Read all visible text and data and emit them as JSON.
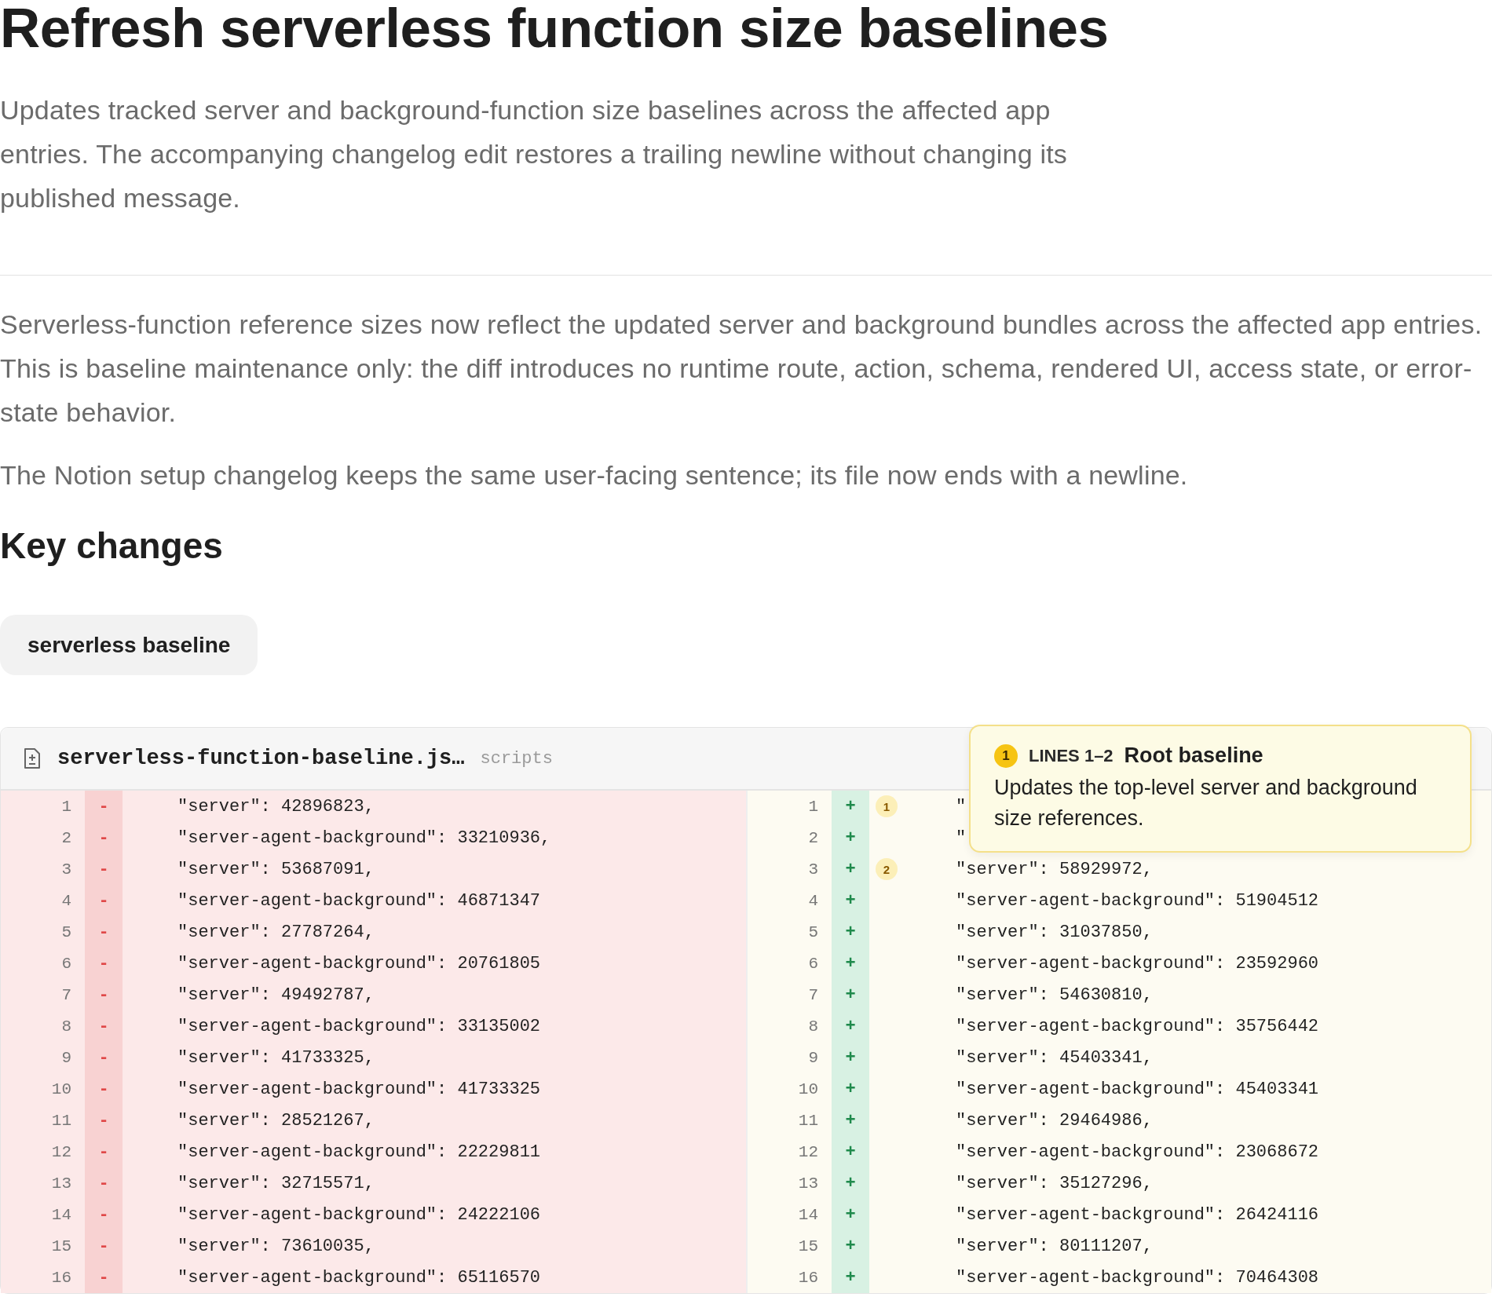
{
  "title": "Refresh serverless function size baselines",
  "summary": "Updates tracked server and background-function size baselines across the affected app entries. The accompanying changelog edit restores a trailing newline without changing its published message.",
  "paragraphs": [
    "Serverless-function reference sizes now reflect the updated server and background bundles across the affected app entries. This is baseline maintenance only: the diff introduces no runtime route, action, schema, rendered UI, access state, or error-state behavior.",
    "The Notion setup changelog keeps the same user-facing sentence; its file now ends with a newline."
  ],
  "heading": "Key changes",
  "tags": [
    {
      "label": "serverless baseline",
      "selected": true
    }
  ],
  "diff": {
    "file": "serverless-function-baseline.js…",
    "path": "scripts",
    "removed": [
      {
        "num": "1",
        "sign": "-",
        "code": "\"server\": 42896823,"
      },
      {
        "num": "2",
        "sign": "-",
        "code": "\"server-agent-background\": 33210936,"
      },
      {
        "num": "3",
        "sign": "-",
        "code": "\"server\": 53687091,"
      },
      {
        "num": "4",
        "sign": "-",
        "code": "\"server-agent-background\": 46871347"
      },
      {
        "num": "5",
        "sign": "-",
        "code": "\"server\": 27787264,"
      },
      {
        "num": "6",
        "sign": "-",
        "code": "\"server-agent-background\": 20761805"
      },
      {
        "num": "7",
        "sign": "-",
        "code": "\"server\": 49492787,"
      },
      {
        "num": "8",
        "sign": "-",
        "code": "\"server-agent-background\": 33135002"
      },
      {
        "num": "9",
        "sign": "-",
        "code": "\"server\": 41733325,"
      },
      {
        "num": "10",
        "sign": "-",
        "code": "\"server-agent-background\": 41733325"
      },
      {
        "num": "11",
        "sign": "-",
        "code": "\"server\": 28521267,"
      },
      {
        "num": "12",
        "sign": "-",
        "code": "\"server-agent-background\": 22229811"
      },
      {
        "num": "13",
        "sign": "-",
        "code": "\"server\": 32715571,"
      },
      {
        "num": "14",
        "sign": "-",
        "code": "\"server-agent-background\": 24222106"
      },
      {
        "num": "15",
        "sign": "-",
        "code": "\"server\": 73610035,"
      },
      {
        "num": "16",
        "sign": "-",
        "code": "\"server-agent-background\": 65116570"
      }
    ],
    "added": [
      {
        "num": "1",
        "sign": "+",
        "badge": "1",
        "code": "\""
      },
      {
        "num": "2",
        "sign": "+",
        "code": "\""
      },
      {
        "num": "3",
        "sign": "+",
        "badge": "2",
        "code": "\"server\": 58929972,"
      },
      {
        "num": "4",
        "sign": "+",
        "code": "\"server-agent-background\": 51904512"
      },
      {
        "num": "5",
        "sign": "+",
        "code": "\"server\": 31037850,"
      },
      {
        "num": "6",
        "sign": "+",
        "code": "\"server-agent-background\": 23592960"
      },
      {
        "num": "7",
        "sign": "+",
        "code": "\"server\": 54630810,"
      },
      {
        "num": "8",
        "sign": "+",
        "code": "\"server-agent-background\": 35756442"
      },
      {
        "num": "9",
        "sign": "+",
        "code": "\"server\": 45403341,"
      },
      {
        "num": "10",
        "sign": "+",
        "code": "\"server-agent-background\": 45403341"
      },
      {
        "num": "11",
        "sign": "+",
        "code": "\"server\": 29464986,"
      },
      {
        "num": "12",
        "sign": "+",
        "code": "\"server-agent-background\": 23068672"
      },
      {
        "num": "13",
        "sign": "+",
        "code": "\"server\": 35127296,"
      },
      {
        "num": "14",
        "sign": "+",
        "code": "\"server-agent-background\": 26424116"
      },
      {
        "num": "15",
        "sign": "+",
        "code": "\"server\": 80111207,"
      },
      {
        "num": "16",
        "sign": "+",
        "code": "\"server-agent-background\": 70464308"
      }
    ],
    "note": {
      "badge": "1",
      "range": "LINES 1–2",
      "title": "Root baseline",
      "text": "Updates the top-level server and background size references."
    }
  }
}
